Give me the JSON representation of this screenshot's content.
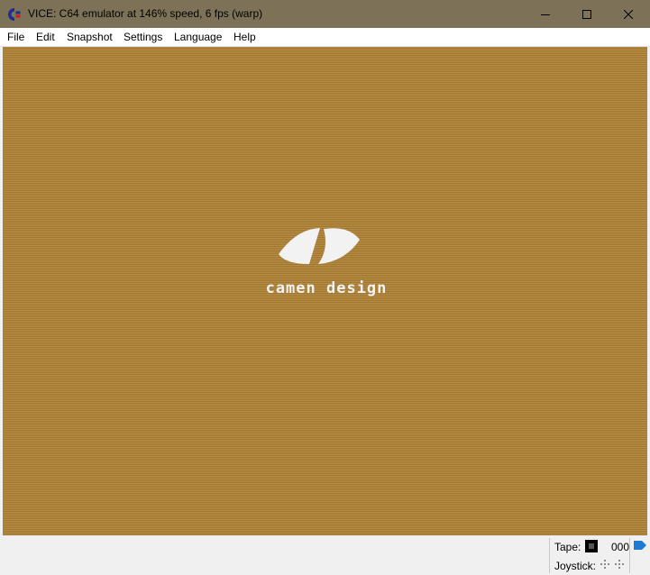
{
  "window": {
    "title": "VICE: C64 emulator at 146% speed, 6 fps (warp)",
    "icon": "commodore-logo-icon"
  },
  "menu": {
    "items": [
      "File",
      "Edit",
      "Snapshot",
      "Settings",
      "Language",
      "Help"
    ]
  },
  "screen": {
    "background_color": "#b0873f",
    "logo_text": "camen design",
    "logo_icon": "eye-logo-icon"
  },
  "status": {
    "tape_label": "Tape:",
    "tape_counter": "000",
    "joystick_label": "Joystick:"
  }
}
